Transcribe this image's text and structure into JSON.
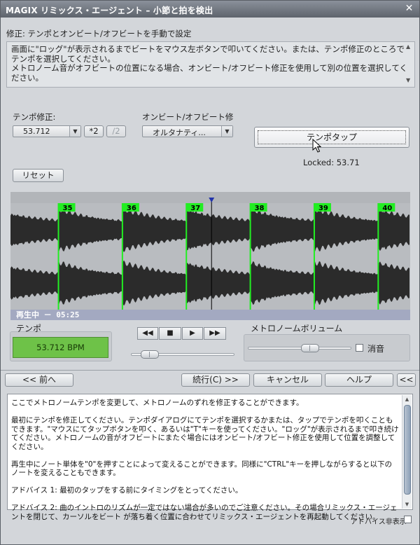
{
  "window": {
    "title": "MAGIX リミックス・エージェント – 小節と拍を検出",
    "close_glyph": "✕"
  },
  "header": {
    "label": "修正: テンポとオンビート/オフビートを手動で設定"
  },
  "instruction": {
    "line1": "画面に\"ロッグ\"が表示されるまでビートをマウス左ボタンで叩いてください。または、テンポ修正のところでテンポを選択してください。",
    "line2": "メトロノーム音がオフビートの位置になる場合、オンビート/オフビート修正を使用して別の位置を選択してください。"
  },
  "tempo_fix": {
    "label": "テンポ修正:",
    "value": "53.712",
    "x2_label": "*2",
    "div2_label": "/2"
  },
  "beat_fix": {
    "label": "オンビート/オフビート修",
    "value": "オルタナティ..."
  },
  "tap": {
    "button_label": "テンポタップ",
    "locked_text": "Locked: 53.71"
  },
  "reset_label": "リセット",
  "waveform": {
    "bar_numbers": [
      "35",
      "36",
      "37",
      "38",
      "39",
      "40"
    ],
    "bar_positions": [
      0.12,
      0.28,
      0.44,
      0.6,
      0.76,
      0.92
    ],
    "playhead_position": 0.503,
    "status_text": "再生中 － 05:25",
    "colors": {
      "beat_line": "#22ee22",
      "wave": "#2b2b2b",
      "bg": "#b9bcc0",
      "status_bg": "#9fa6c0"
    }
  },
  "tempo_display": {
    "label": "テンポ",
    "value": "53.712 BPM"
  },
  "transport": {
    "rewind_glyph": "◀◀",
    "stop_glyph": "■",
    "play_glyph": "▶",
    "forward_glyph": "▶▶",
    "position_level": 0.18
  },
  "metronome": {
    "label": "メトロノームボリューム",
    "level": 0.6,
    "mute_label": "消音",
    "muted": false
  },
  "nav": {
    "prev_label": "<< 前へ",
    "next_label": "続行(C) >>",
    "cancel_label": "キャンセル",
    "help_label": "ヘルプ",
    "collapse_label": "<<"
  },
  "advice": {
    "p1": "ここでメトロノームテンポを変更して、メトロノームのずれを修正することができます。",
    "p2": "最初にテンポを修正してください。テンポダイアログにてテンポを選択するかまたは、タップでテンポを叩くこともできます。\"マウスにてタップボタンを叩く、あるいは\"T\"キーを使ってください。\"ロッグ\"が表示されるまで叩き続けてください。メトロノームの音がオフビートにまたぐ場合にはオンビート/オフビート修正を使用して位置を調整してください。",
    "p3": "再生中にノート単体を\"0\"を押すことによって変えることができます。同様に\"CTRL\"キーを押しながらすると以下のノートを変えることもできます。",
    "p4": "アドバイス 1:  最初のタップをする前にタイミングをとってください。",
    "p5": "アドバイス 2:  曲のイントロのリズムが一定ではない場合が多いのでご注意ください。その場合リミックス・エージェントを閉じて、カーソルをビート が落ち着く位置に合わせてリミックス・エージェントを再起動してください。",
    "hide_label": "アドバイス非表示"
  }
}
